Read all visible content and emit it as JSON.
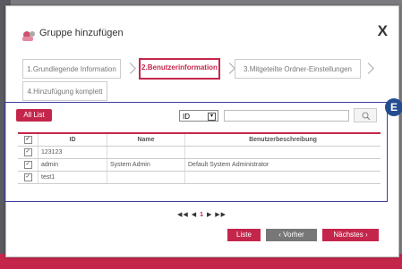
{
  "dialog": {
    "title": "Gruppe hinzufügen",
    "close_label": "X"
  },
  "steps": [
    {
      "label": "1.Grundlegende Information"
    },
    {
      "label": "2.Benutzerinformation"
    },
    {
      "label": "3.Mitgeteilte Ordner-Einstellungen"
    },
    {
      "label": "4.Hinzufügung komplett"
    }
  ],
  "badge": "E",
  "toolbar": {
    "all_list_label": "All List",
    "search_field_select": "ID",
    "search_value": ""
  },
  "table": {
    "headers": [
      "",
      "ID",
      "Name",
      "Benutzerbeschreibung"
    ],
    "rows": [
      {
        "checked": "✓",
        "id": "123123",
        "name": "",
        "desc": ""
      },
      {
        "checked": "✓",
        "id": "admin",
        "name": "System Admin",
        "desc": "Default System Administrator"
      },
      {
        "checked": "✓",
        "id": "test1",
        "name": "",
        "desc": ""
      }
    ],
    "header_check": "✓"
  },
  "pager": {
    "first": "◀◀",
    "prev": "◀",
    "page": "1",
    "next": "▶",
    "last": "▶▶"
  },
  "buttons": {
    "liste": "Liste",
    "vorher": "‹ Vorher",
    "next": "Nächstes ›"
  },
  "colors": {
    "accent": "#c4264b",
    "panel_border": "#3b3fa0",
    "badge": "#244d8f"
  }
}
